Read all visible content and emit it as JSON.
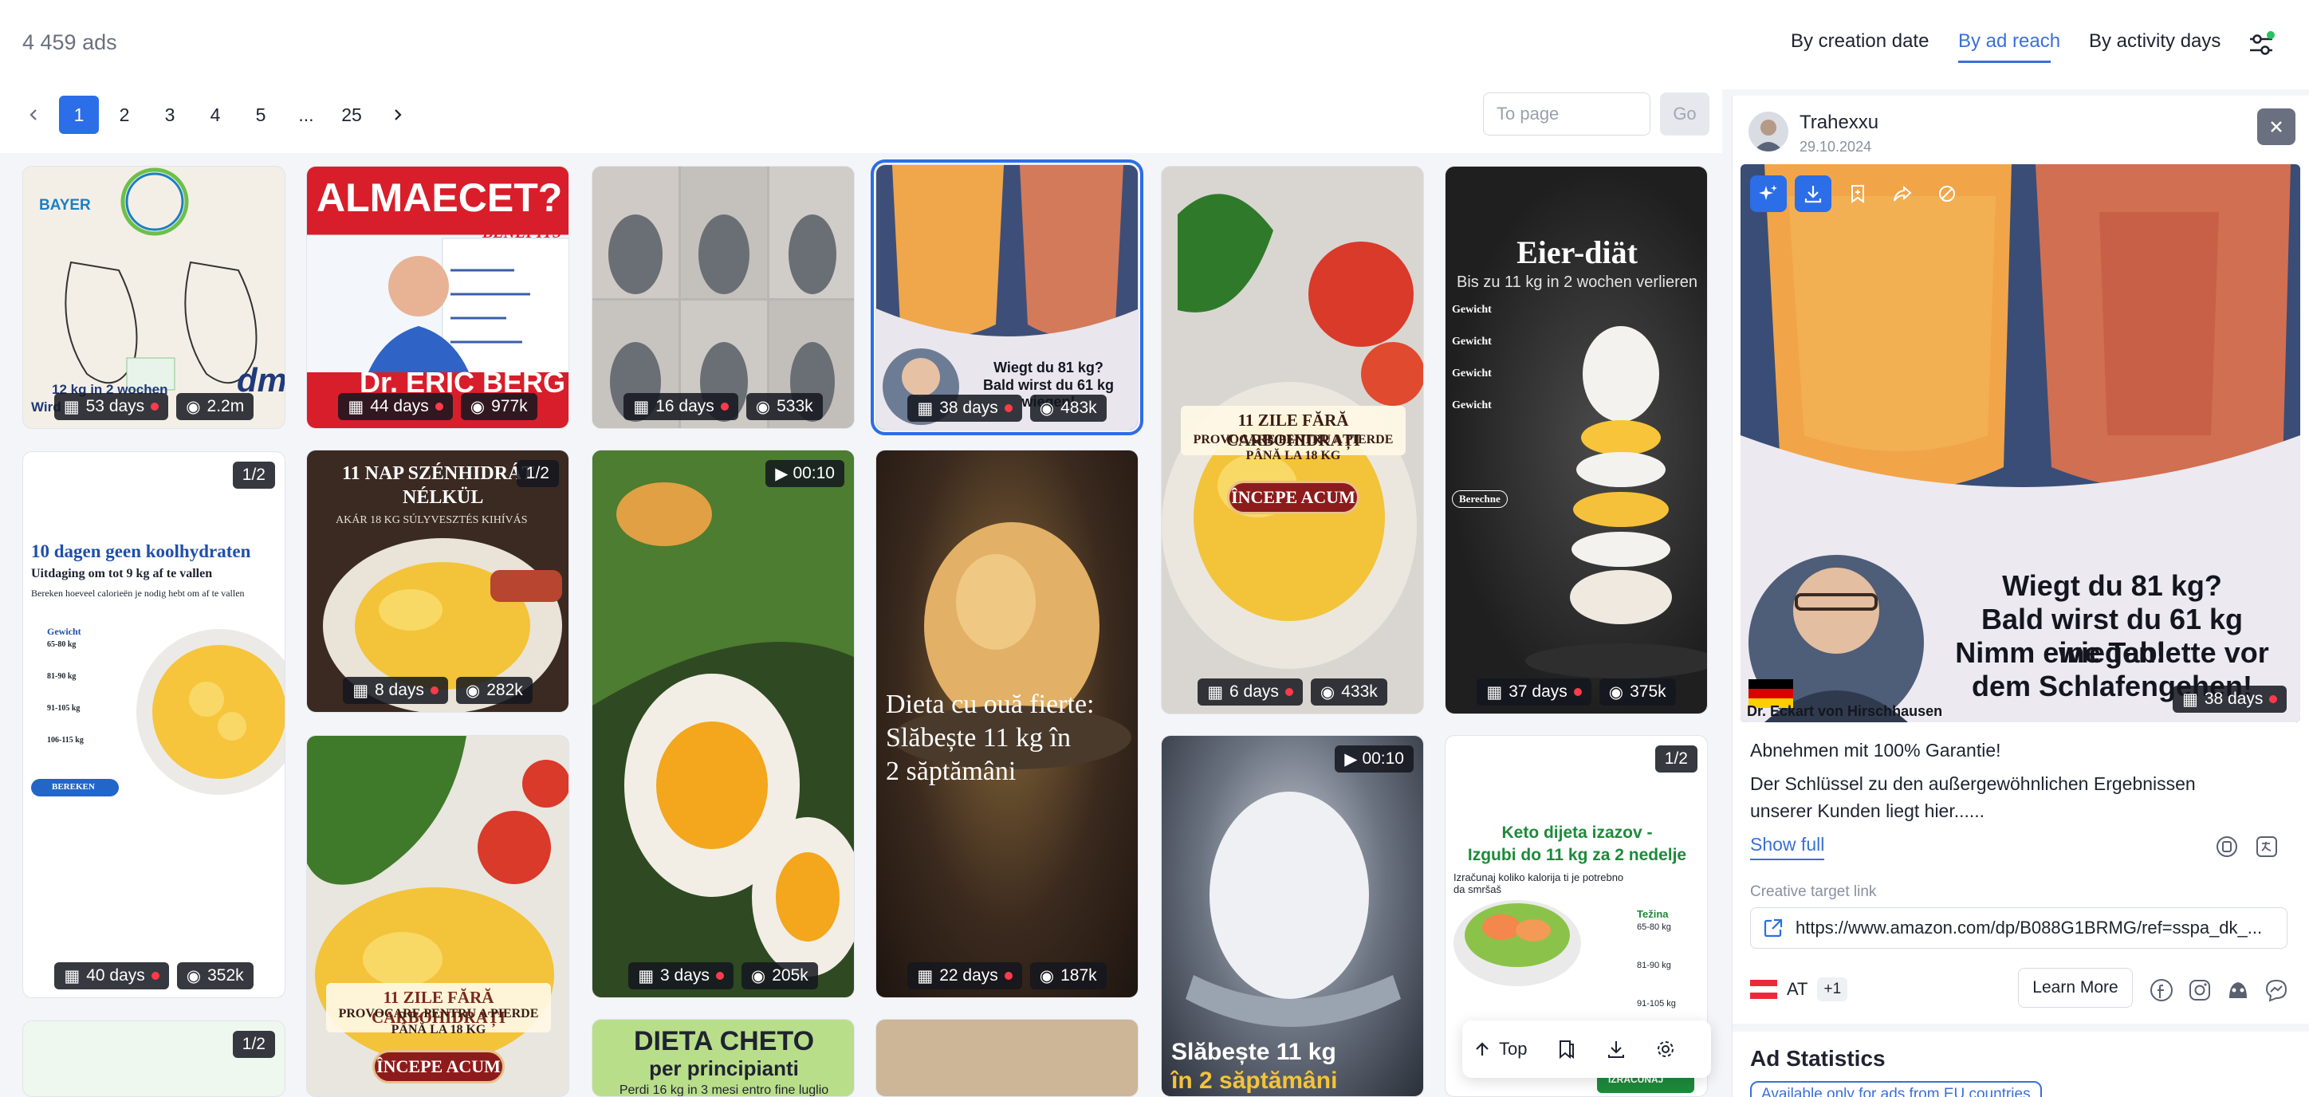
{
  "header": {
    "ads_count": "4 459 ads",
    "sort_tabs": [
      "By creation date",
      "By ad reach",
      "By activity days"
    ],
    "active_sort": "By ad reach"
  },
  "pagination": {
    "pages": [
      "1",
      "2",
      "3",
      "4",
      "5",
      "...",
      "25"
    ],
    "current": "1",
    "to_page_placeholder": "To page",
    "go_label": "Go"
  },
  "cards": [
    {
      "days": "53 days",
      "reach": "2.2m",
      "text": [
        "BAYER",
        "12 kg in 2 wochen",
        "Wird ni",
        "dm"
      ]
    },
    {
      "days": "44 days",
      "reach": "977k",
      "text": [
        "ALMAECET?",
        "BENEFITS",
        "Dr. ERIC BERG"
      ]
    },
    {
      "days": "16 days",
      "reach": "533k",
      "text": []
    },
    {
      "days": "38 days",
      "reach": "483k",
      "text": [
        "Wiegt du 81 kg?",
        "Bald wirst du 61 kg wiegen!"
      ]
    },
    {
      "days": "6 days",
      "reach": "433k",
      "text": [
        "11 ZILE FĂRĂ CARBOHIDRAȚI",
        "PROVOCARE PENTRU A PIERDE",
        "PÂNĂ LA 18 KG",
        "ÎNCEPE ACUM"
      ]
    },
    {
      "days": "37 days",
      "reach": "375k",
      "text": [
        "Eier-diät",
        "Bis zu 11 kg in 2 wochen verlieren",
        "Gewicht",
        "Berechne"
      ]
    },
    {
      "days": "40 days",
      "reach": "352k",
      "badge": "1/2",
      "text": [
        "10 dagen geen koolhydraten",
        "Uitdaging om tot 9 kg af te vallen",
        "Bereken hoeveel calorieën je nodig hebt om af te vallen",
        "Gewicht",
        "65-80 kg",
        "81-90 kg",
        "91-105 kg",
        "106-115 kg",
        "BEREKEN"
      ]
    },
    {
      "days": "8 days",
      "reach": "282k",
      "badge": "1/2",
      "text": [
        "11 NAP SZÉNHIDRÁT",
        "NÉLKÜL",
        "AKÁR 18 KG SÚLYVESZTÉS KIHÍVÁS"
      ]
    },
    {
      "days": "3 days",
      "reach": "205k",
      "badge": "00:10",
      "text": []
    },
    {
      "days": "22 days",
      "reach": "187k",
      "text": [
        "Dieta cu ouă fierte:",
        "Slăbește 11 kg în",
        "2 săptămâni"
      ]
    },
    {
      "badge": "00:10",
      "text": [
        "Slăbește 11 kg",
        "în 2 săptămâni"
      ]
    },
    {
      "badge": "1/2",
      "text": [
        "Keto dijeta izazov -",
        "Izgubi do 11 kg za 2 nedelje",
        "Izračunaj koliko kalorija ti je potrebno da smršaš",
        "Težina",
        "65-80 kg",
        "81-90 kg",
        "91-105 kg",
        "IZRAČUNAJ"
      ]
    },
    {
      "text": [
        "11 ZILE FĂRĂ CARBOHIDRAȚI",
        "PROVOCARE PENTRU A PIERDE",
        "PÂNĂ LA 18 KG",
        "ÎNCEPE ACUM"
      ]
    },
    {
      "text": [
        "DIETA CHETO",
        "per principianti",
        "Perdi 16 kg in 3 mesi entro fine luglio"
      ]
    },
    {
      "badge": "1/2",
      "text": []
    }
  ],
  "float_toolbar": {
    "top_label": "Top"
  },
  "panel": {
    "advertiser": "Trahexxu",
    "date": "29.10.2024",
    "image_text": [
      "Wiegt du 81 kg?",
      "Bald wirst du 61 kg wiegen!",
      "Nimm eine Tablette vor",
      "dem Schlafengehen!",
      "Dr. Eckart von Hirschhausen"
    ],
    "days": "38 days",
    "headline": "Abnehmen mit 100% Garantie!",
    "body": "Der Schlüssel zu den außergewöhnlichen Ergebnissen unserer Kunden liegt hier......",
    "show_full": "Show full",
    "link_label": "Creative target link",
    "link": "https://www.amazon.com/dp/B088G1BRMG/ref=sspa_dk_...",
    "country": "AT",
    "country_more": "+1",
    "cta": "Learn More",
    "stats_title": "Ad Statistics",
    "eu_note": "Available only for ads from EU countries"
  },
  "colors": {
    "accent": "#2b6ee8",
    "live_dot": "#ff3b4a",
    "pill_bg": "#14161e"
  }
}
